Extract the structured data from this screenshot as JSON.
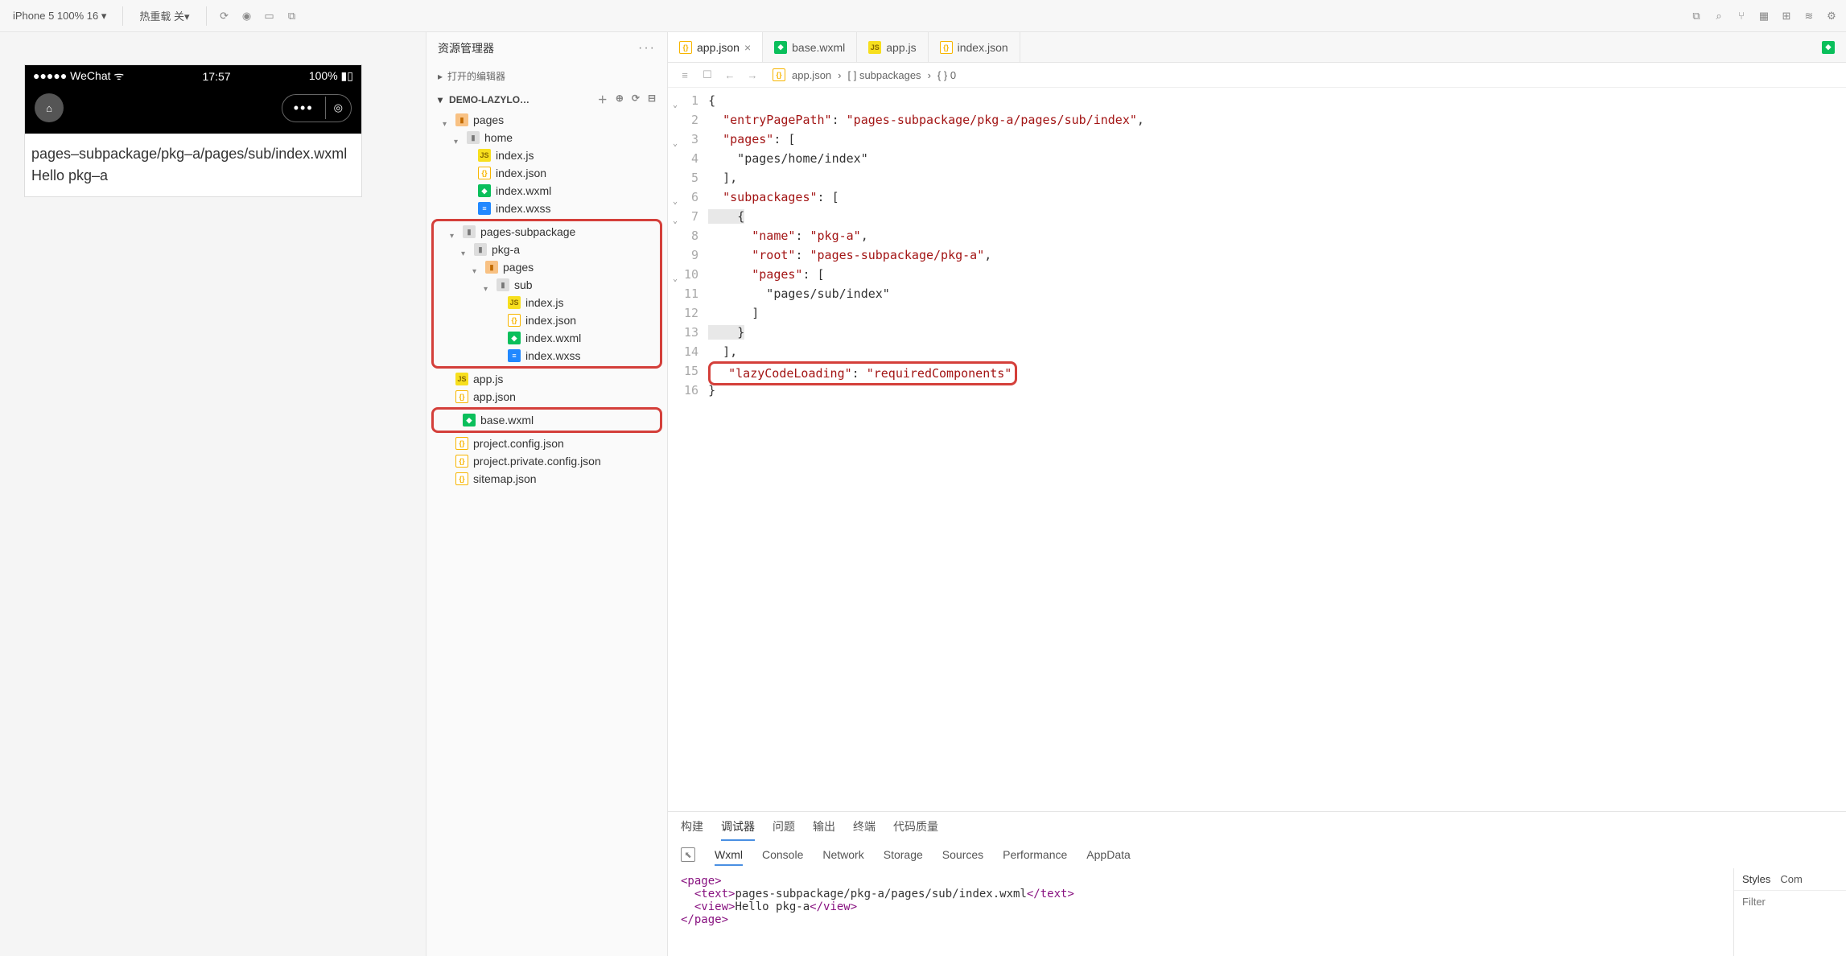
{
  "topbar": {
    "device": "iPhone 5 100% 16 ▾",
    "hotreload": "热重载 关▾"
  },
  "simulator": {
    "status_left": "●●●●● WeChat",
    "status_time": "17:57",
    "status_right": "100%",
    "body_line1": "pages–subpackage/pkg–a/pages/sub/index.wxml",
    "body_line2": "Hello pkg–a"
  },
  "explorer": {
    "title": "资源管理器",
    "open_editors": "打开的编辑器",
    "project": "DEMO-LAZYLO…",
    "tree": [
      {
        "d": 0,
        "t": "folder-open",
        "n": "pages",
        "open": true
      },
      {
        "d": 1,
        "t": "folder",
        "n": "home",
        "open": true
      },
      {
        "d": 2,
        "t": "js",
        "n": "index.js"
      },
      {
        "d": 2,
        "t": "json",
        "n": "index.json"
      },
      {
        "d": 2,
        "t": "wxml",
        "n": "index.wxml"
      },
      {
        "d": 2,
        "t": "wxss",
        "n": "index.wxss"
      }
    ],
    "tree_red": [
      {
        "d": 0,
        "t": "folder",
        "n": "pages-subpackage",
        "open": true
      },
      {
        "d": 1,
        "t": "folder",
        "n": "pkg-a",
        "open": true
      },
      {
        "d": 2,
        "t": "folder-open",
        "n": "pages",
        "open": true
      },
      {
        "d": 3,
        "t": "folder",
        "n": "sub",
        "open": true
      },
      {
        "d": 4,
        "t": "js",
        "n": "index.js"
      },
      {
        "d": 4,
        "t": "json",
        "n": "index.json"
      },
      {
        "d": 4,
        "t": "wxml",
        "n": "index.wxml"
      },
      {
        "d": 4,
        "t": "wxss",
        "n": "index.wxss"
      }
    ],
    "tree2": [
      {
        "d": 0,
        "t": "js",
        "n": "app.js"
      },
      {
        "d": 0,
        "t": "json",
        "n": "app.json"
      }
    ],
    "tree_red2": [
      {
        "d": 0,
        "t": "wxml",
        "n": "base.wxml"
      }
    ],
    "tree3": [
      {
        "d": 0,
        "t": "json",
        "n": "project.config.json"
      },
      {
        "d": 0,
        "t": "json",
        "n": "project.private.config.json"
      },
      {
        "d": 0,
        "t": "json",
        "n": "sitemap.json"
      }
    ]
  },
  "editor": {
    "tabs": [
      {
        "icon": "json",
        "label": "app.json",
        "active": true,
        "close": true
      },
      {
        "icon": "wxml",
        "label": "base.wxml"
      },
      {
        "icon": "js",
        "label": "app.js"
      },
      {
        "icon": "json",
        "label": "index.json"
      }
    ],
    "breadcrumb": [
      "app.json",
      "[ ] subpackages",
      "{ } 0"
    ],
    "lines": [
      "{",
      "  \"entryPagePath\": \"pages-subpackage/pkg-a/pages/sub/index\",",
      "  \"pages\": [",
      "    \"pages/home/index\"",
      "  ],",
      "  \"subpackages\": [",
      "    {",
      "      \"name\": \"pkg-a\",",
      "      \"root\": \"pages-subpackage/pkg-a\",",
      "      \"pages\": [",
      "        \"pages/sub/index\"",
      "      ]",
      "    }",
      "  ],",
      "  \"lazyCodeLoading\": \"requiredComponents\"",
      "}"
    ]
  },
  "panel": {
    "tabs": [
      "构建",
      "调试器",
      "问题",
      "输出",
      "终端",
      "代码质量"
    ],
    "active_tab": 1,
    "devtabs": [
      "Wxml",
      "Console",
      "Network",
      "Storage",
      "Sources",
      "Performance",
      "AppData"
    ],
    "active_devtab": 0,
    "dom_lines": [
      {
        "tag": "<page>",
        "indent": 0
      },
      {
        "tag": "<text>",
        "text": "pages-subpackage/pkg-a/pages/sub/index.wxml",
        "close": "</text>",
        "indent": 1
      },
      {
        "tag": "<view>",
        "text": "Hello pkg-a",
        "close": "</view>",
        "indent": 1
      },
      {
        "tag": "</page>",
        "indent": 0
      }
    ],
    "side_tabs": [
      "Styles",
      "Com"
    ],
    "filter_placeholder": "Filter"
  }
}
